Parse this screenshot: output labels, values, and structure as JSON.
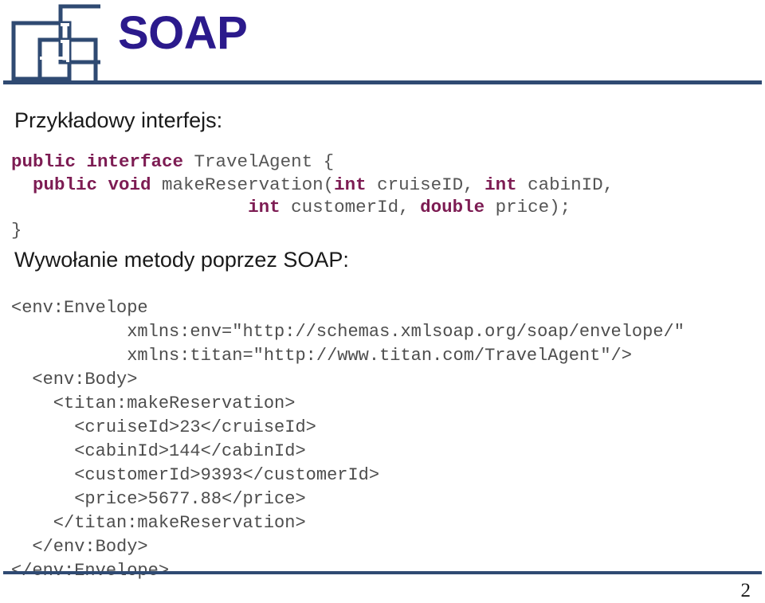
{
  "header": {
    "title": "SOAP",
    "logo_icon": "three-overlapping-squares-logo",
    "logo_color": "#2f4a72",
    "title_color": "#2b1a8c",
    "rule_color": "#2f4a72"
  },
  "body": {
    "heading_interface": "Przykładowy interfejs:",
    "heading_invocation": "Wywołanie metody poprzez SOAP:",
    "java_code": {
      "keyword_color": "#7d1c53",
      "text_color": "#4a4a4a",
      "lines": [
        [
          {
            "t": "public interface ",
            "s": "kw"
          },
          {
            "t": "TravelAgent {",
            "s": "ident"
          }
        ],
        [
          {
            "t": "  ",
            "s": "ident"
          },
          {
            "t": "public void ",
            "s": "kw"
          },
          {
            "t": "makeReservation(",
            "s": "ident"
          },
          {
            "t": "int",
            "s": "kw"
          },
          {
            "t": " cruiseID, ",
            "s": "ident"
          },
          {
            "t": "int",
            "s": "kw"
          },
          {
            "t": " cabinID,",
            "s": "ident"
          }
        ],
        [
          {
            "t": "                      ",
            "s": "ident"
          },
          {
            "t": "int",
            "s": "kw"
          },
          {
            "t": " customerId, ",
            "s": "ident"
          },
          {
            "t": "double",
            "s": "kw"
          },
          {
            "t": " price);",
            "s": "ident"
          }
        ],
        [
          {
            "t": "}",
            "s": "ident"
          }
        ]
      ]
    },
    "xml_code": {
      "text_color": "#4d4d4d",
      "lines": [
        "<env:Envelope",
        "           xmlns:env=\"http://schemas.xmlsoap.org/soap/envelope/\"",
        "           xmlns:titan=\"http://www.titan.com/TravelAgent\"/>",
        "  <env:Body>",
        "    <titan:makeReservation>",
        "      <cruiseId>23</cruiseId>",
        "      <cabinId>144</cabinId>",
        "      <customerId>9393</customerId>",
        "      <price>5677.88</price>",
        "    </titan:makeReservation>",
        "  </env:Body>",
        "</env:Envelope>"
      ]
    }
  },
  "footer": {
    "page_number": "2",
    "rule_color": "#2f4a72"
  }
}
